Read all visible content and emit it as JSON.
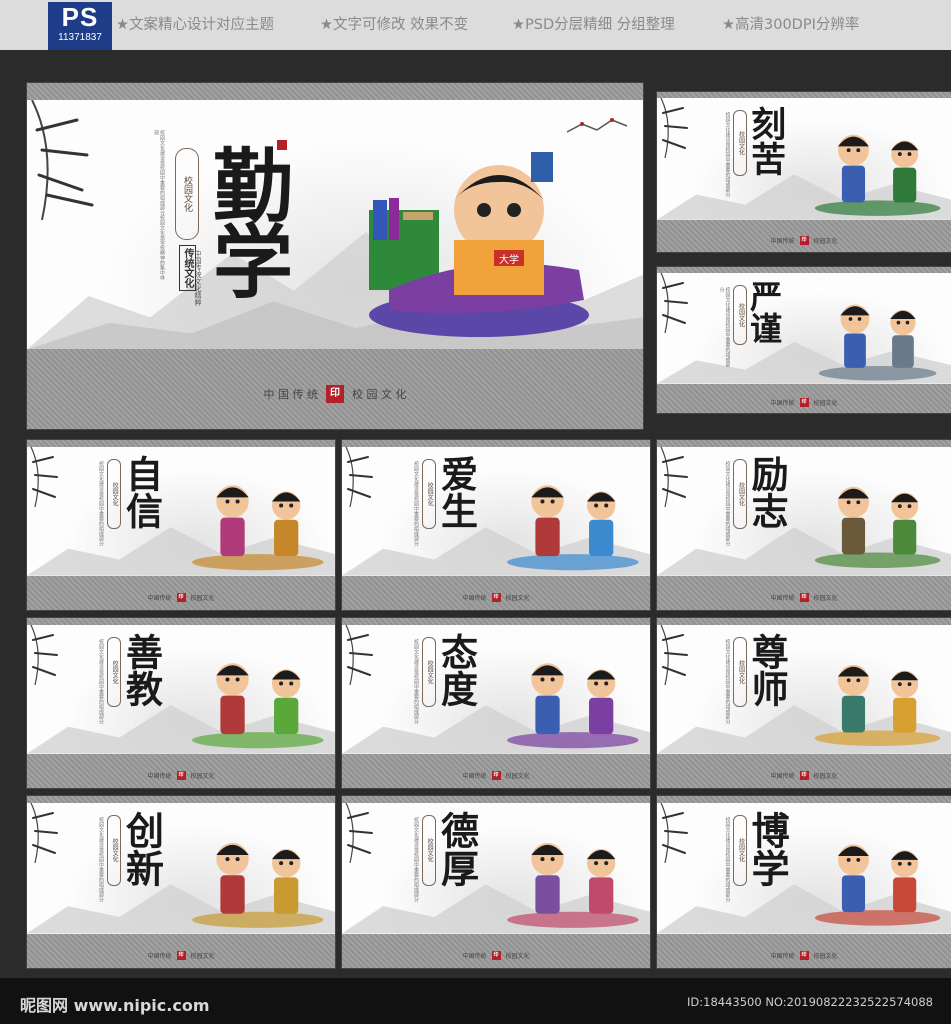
{
  "header": {
    "ps_label": "PS",
    "id_number": "11371837",
    "features": [
      "★文案精心设计对应主题",
      "★文字可修改 效果不变",
      "★PSD分层精细 分组整理",
      "★高清300DPI分辨率"
    ]
  },
  "main_panel": {
    "title": "勤学",
    "badge": "校园文化",
    "tag": "传统文化",
    "subtitle": "中国传统文化精粹",
    "strip_left": "中 国 传 统",
    "strip_right": "校 园 文 化",
    "book_label": "大学"
  },
  "small_panels": [
    {
      "title": "刻苦"
    },
    {
      "title": "严谨"
    },
    {
      "title": "自信"
    },
    {
      "title": "爱生"
    },
    {
      "title": "励志"
    },
    {
      "title": "善教"
    },
    {
      "title": "态度"
    },
    {
      "title": "尊师"
    },
    {
      "title": "创新"
    },
    {
      "title": "德厚"
    },
    {
      "title": "博学"
    }
  ],
  "small_strip": {
    "left": "中国传统",
    "right": "校园文化"
  },
  "footer": {
    "site": "昵图网 www.nipic.com",
    "id_text": "ID:18443500 NO:20190822232522574088"
  },
  "colors": {
    "seal": "#b3202a",
    "frame": "#9a9a9a",
    "logo": "#1f3c88"
  }
}
